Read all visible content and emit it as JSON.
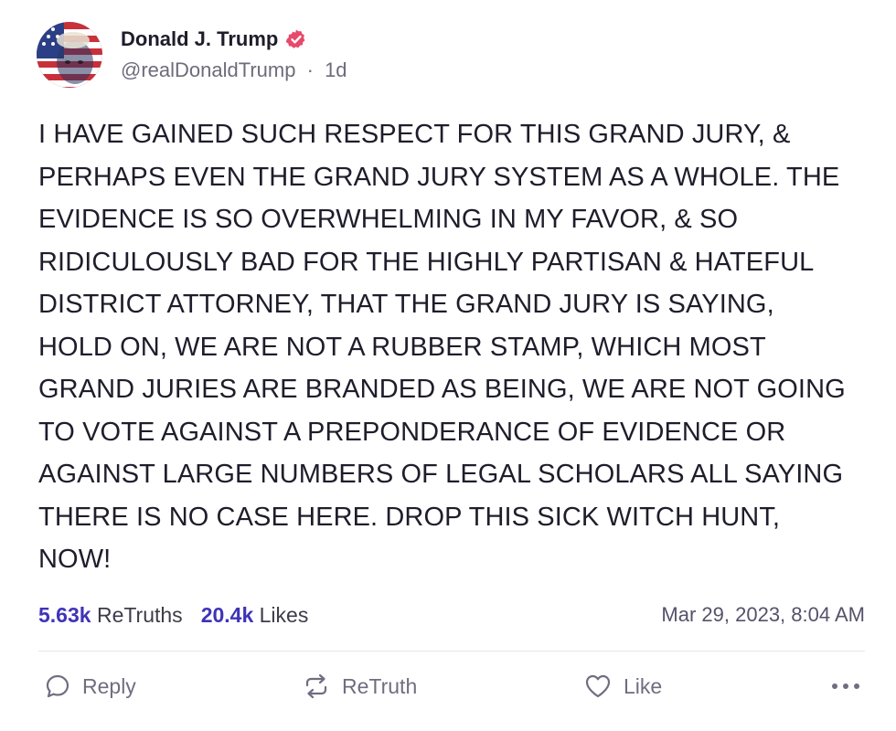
{
  "author": {
    "display_name": "Donald J. Trump",
    "handle": "@realDonaldTrump",
    "separator": "·",
    "age": "1d",
    "verified": true
  },
  "post": {
    "text": "I HAVE GAINED SUCH RESPECT FOR THIS GRAND JURY, & PERHAPS EVEN THE GRAND JURY SYSTEM AS A WHOLE. THE EVIDENCE IS SO OVERWHELMING IN MY FAVOR, & SO RIDICULOUSLY BAD FOR THE HIGHLY PARTISAN & HATEFUL DISTRICT ATTORNEY, THAT THE GRAND JURY IS SAYING, HOLD ON, WE ARE NOT A RUBBER STAMP, WHICH MOST GRAND JURIES ARE BRANDED AS BEING, WE ARE NOT GOING TO VOTE AGAINST A PREPONDERANCE OF EVIDENCE OR AGAINST LARGE NUMBERS OF LEGAL SCHOLARS ALL SAYING THERE IS NO CASE HERE. DROP THIS SICK WITCH HUNT, NOW!",
    "lines": [
      "I HAVE GAINED SUCH RESPECT FOR THIS GRAND JURY, &",
      "PERHAPS EVEN THE GRAND JURY SYSTEM AS A WHOLE. THE",
      "EVIDENCE IS SO OVERWHELMING IN MY FAVOR, & SO",
      "RIDICULOUSLY BAD FOR THE HIGHLY PARTISAN & HATEFUL",
      "DISTRICT ATTORNEY, THAT THE GRAND JURY IS SAYING,",
      "HOLD ON, WE ARE NOT A RUBBER STAMP, WHICH MOST",
      "GRAND JURIES ARE BRANDED AS BEING, WE ARE NOT GOING",
      "TO VOTE AGAINST A PREPONDERANCE OF EVIDENCE OR",
      "AGAINST LARGE NUMBERS OF LEGAL SCHOLARS ALL SAYING",
      "THERE IS NO CASE HERE. DROP THIS SICK WITCH HUNT,",
      "NOW!"
    ]
  },
  "stats": {
    "retruths_count": "5.63k",
    "retruths_label": "ReTruths",
    "likes_count": "20.4k",
    "likes_label": "Likes",
    "timestamp": "Mar 29, 2023, 8:04 AM"
  },
  "actions": {
    "reply_label": "Reply",
    "retruth_label": "ReTruth",
    "like_label": "Like",
    "more_icon": "more-dots-icon"
  },
  "icons": {
    "reply": "reply-bubble-icon",
    "retruth": "retruth-arrows-icon",
    "like": "heart-icon",
    "verified": "verified-badge-icon"
  },
  "colors": {
    "accent": "#3f33b8",
    "verified_badge": "#e8496a",
    "text": "#1f1d2b",
    "muted": "#6e6b7b"
  }
}
